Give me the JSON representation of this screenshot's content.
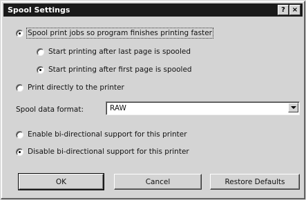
{
  "window": {
    "title": "Spool Settings",
    "help_label": "?",
    "close_label": "×"
  },
  "options": {
    "spool": {
      "label": "Spool print jobs so program finishes printing faster",
      "checked": true
    },
    "after_last": {
      "label": "Start printing after last page is spooled",
      "checked": false
    },
    "after_first": {
      "label": "Start printing after first page is spooled",
      "checked": true
    },
    "direct": {
      "label": "Print directly to the printer",
      "checked": false
    }
  },
  "spool_format": {
    "label": "Spool data format:",
    "value": "RAW"
  },
  "bidi": {
    "enable": {
      "label": "Enable bi-directional support for this printer",
      "checked": false
    },
    "disable": {
      "label": "Disable bi-directional support for this printer",
      "checked": true
    }
  },
  "buttons": {
    "ok": "OK",
    "cancel": "Cancel",
    "restore": "Restore Defaults"
  }
}
